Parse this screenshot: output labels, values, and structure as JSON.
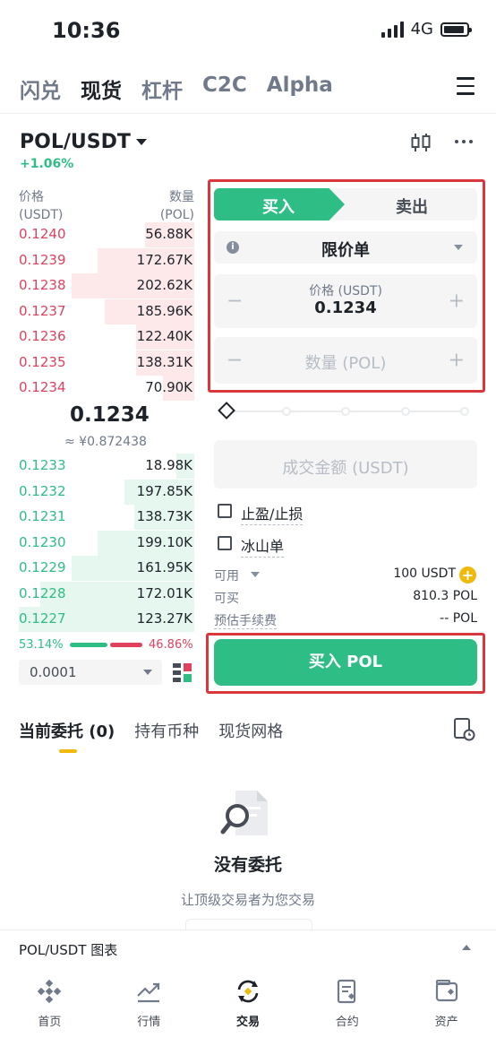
{
  "status_bar": {
    "time": "10:36",
    "network": "4G"
  },
  "top_tabs": [
    {
      "label": "闪兑",
      "active": false
    },
    {
      "label": "现货",
      "active": true
    },
    {
      "label": "杠杆",
      "active": false
    },
    {
      "label": "C2C",
      "active": false
    },
    {
      "label": "Alpha",
      "active": false
    }
  ],
  "pair": {
    "symbol": "POL/USDT",
    "change": "+1.06%"
  },
  "order_book": {
    "price_header": "价格",
    "price_unit": "(USDT)",
    "qty_header": "数量",
    "qty_unit": "(POL)",
    "asks": [
      {
        "price": "0.1240",
        "qty": "56.88K",
        "depth": 0.28
      },
      {
        "price": "0.1239",
        "qty": "172.67K",
        "depth": 0.55
      },
      {
        "price": "0.1238",
        "qty": "202.62K",
        "depth": 0.7
      },
      {
        "price": "0.1237",
        "qty": "185.96K",
        "depth": 0.51
      },
      {
        "price": "0.1236",
        "qty": "122.40K",
        "depth": 0.33
      },
      {
        "price": "0.1235",
        "qty": "138.31K",
        "depth": 0.33
      },
      {
        "price": "0.1234",
        "qty": "70.90K",
        "depth": 0.18
      }
    ],
    "mid_price": "0.1234",
    "mid_price_cny": "≈ ¥0.872438",
    "bids": [
      {
        "price": "0.1233",
        "qty": "18.98K",
        "depth": 0.1
      },
      {
        "price": "0.1232",
        "qty": "197.85K",
        "depth": 0.4
      },
      {
        "price": "0.1231",
        "qty": "138.73K",
        "depth": 0.34
      },
      {
        "price": "0.1230",
        "qty": "199.10K",
        "depth": 0.55
      },
      {
        "price": "0.1229",
        "qty": "161.95K",
        "depth": 0.7
      },
      {
        "price": "0.1228",
        "qty": "172.01K",
        "depth": 0.88
      },
      {
        "price": "0.1227",
        "qty": "123.27K",
        "depth": 1.0
      }
    ],
    "buy_ratio": "53.14%",
    "sell_ratio": "46.86%",
    "precision": "0.0001"
  },
  "trade_form": {
    "buy_label": "买入",
    "sell_label": "卖出",
    "order_type": "限价单",
    "price_label": "价格 (USDT)",
    "price_value": "0.1234",
    "qty_placeholder": "数量 (POL)",
    "amount_placeholder": "成交金额 (USDT)",
    "tp_sl_label": "止盈/止损",
    "iceberg_label": "冰山单",
    "available_label": "可用",
    "available_value": "100 USDT",
    "can_buy_label": "可买",
    "can_buy_value": "810.3 POL",
    "fee_label": "预估手续费",
    "fee_value": "-- POL",
    "submit_label": "买入 POL"
  },
  "orders_section": {
    "tabs": [
      {
        "label": "当前委托 (0)",
        "active": true
      },
      {
        "label": "持有币种",
        "active": false
      },
      {
        "label": "现货网格",
        "active": false
      }
    ],
    "empty_title": "没有委托",
    "empty_subtitle": "让顶级交易者为您交易"
  },
  "chart_bar": {
    "label": "POL/USDT 图表"
  },
  "bottom_nav": [
    {
      "label": "首页",
      "icon": "binance-logo-icon",
      "active": false
    },
    {
      "label": "行情",
      "icon": "market-trend-icon",
      "active": false
    },
    {
      "label": "交易",
      "icon": "trade-exchange-icon",
      "active": true
    },
    {
      "label": "合约",
      "icon": "futures-contract-icon",
      "active": false
    },
    {
      "label": "资产",
      "icon": "wallet-icon",
      "active": false
    }
  ],
  "colors": {
    "green": "#2ebd85",
    "red": "#e0415d",
    "yellow": "#f0b90b",
    "highlight": "#d9363e"
  }
}
